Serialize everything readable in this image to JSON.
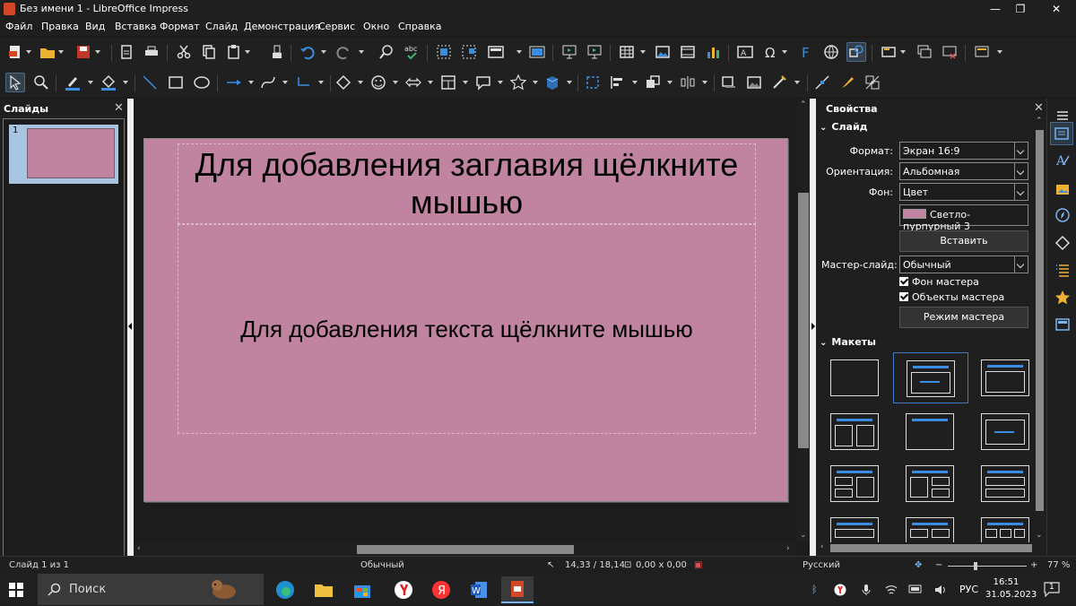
{
  "window": {
    "title": "Без имени 1 - LibreOffice Impress",
    "controls": {
      "minimize": "—",
      "maximize": "❐",
      "close": "✕"
    }
  },
  "menu": [
    "Файл",
    "Правка",
    "Вид",
    "Вставка",
    "Формат",
    "Слайд",
    "Демонстрация",
    "Сервис",
    "Окно",
    "Справка"
  ],
  "slides_panel": {
    "title": "Слайды",
    "close": "✕",
    "thumbnails": [
      {
        "number": "1",
        "color": "#c084a0"
      }
    ]
  },
  "slide": {
    "background": "#c084a0",
    "title_placeholder": "Для добавления заглавия щёлкните мышью",
    "body_placeholder": "Для добавления текста щёлкните мышью"
  },
  "properties": {
    "title": "Свойства",
    "close": "✕",
    "slide_section": "Слайд",
    "format_label": "Формат:",
    "format_value": "Экран 16:9",
    "orientation_label": "Ориентация:",
    "orientation_value": "Альбомная",
    "background_label": "Фон:",
    "background_value": "Цвет",
    "color_value": "Светло-пурпурный 3",
    "color_swatch": "#c084a0",
    "insert_image": "Вставить изображение...",
    "master_label": "Мастер-слайд:",
    "master_value": "Обычный",
    "master_background": "Фон мастера",
    "master_objects": "Объекты мастера",
    "master_mode": "Режим мастера",
    "layouts_section": "Макеты",
    "accent_color": "#3a8de0"
  },
  "status": {
    "slide_info": "Слайд 1 из 1",
    "master": "Обычный",
    "position": "14,33 / 18,14",
    "size": "0,00 x 0,00",
    "language": "Русский",
    "zoom": "77 %"
  },
  "taskbar": {
    "search_label": "Поиск",
    "language": "РУС",
    "time": "16:51",
    "date": "31.05.2023",
    "notifications": "1"
  }
}
